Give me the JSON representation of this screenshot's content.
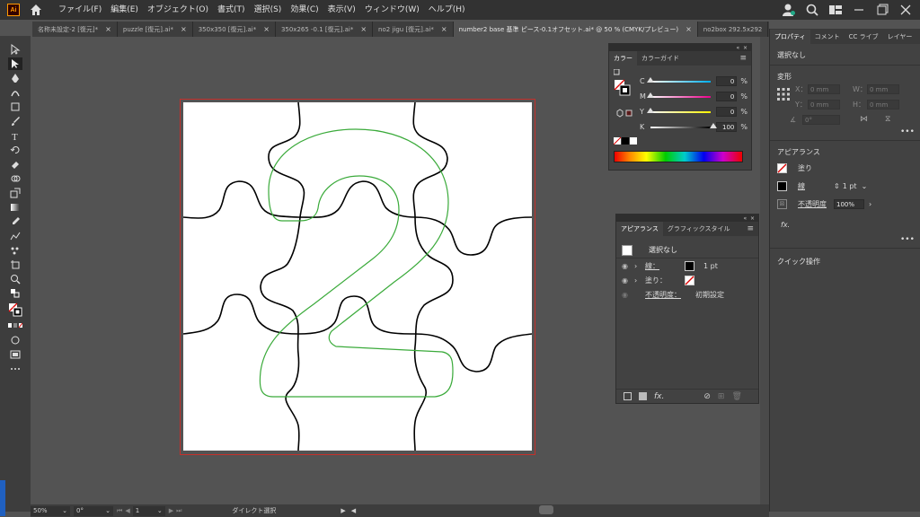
{
  "app": {
    "logo": "Ai"
  },
  "menu": [
    "ファイル(F)",
    "編集(E)",
    "オブジェクト(O)",
    "書式(T)",
    "選択(S)",
    "効果(C)",
    "表示(V)",
    "ウィンドウ(W)",
    "ヘルプ(H)"
  ],
  "tabs": [
    {
      "label": "名称未設定-2 [復元]* ",
      "active": false
    },
    {
      "label": "puzzle [復元].ai*",
      "active": false
    },
    {
      "label": "350x350 [復元].ai*",
      "active": false
    },
    {
      "label": "350x265 -0.1 [復元].ai*",
      "active": false
    },
    {
      "label": "no2 jigu [復元].ai*",
      "active": false
    },
    {
      "label": "number2 base 基準 ピース-0.1オフセット.ai* @ 50 % (CMYK/プレビュー)",
      "active": true
    },
    {
      "label": "no2box 292.5x292",
      "active": false
    }
  ],
  "color_panel": {
    "tabs": [
      "カラー",
      "カラーガイド"
    ],
    "channels": [
      {
        "label": "C",
        "value": "0",
        "fraction": 0.0
      },
      {
        "label": "M",
        "value": "0",
        "fraction": 0.0
      },
      {
        "label": "Y",
        "value": "0",
        "fraction": 0.0
      },
      {
        "label": "K",
        "value": "100",
        "fraction": 1.0
      }
    ],
    "unit": "%"
  },
  "appearance_panel": {
    "tabs": [
      "アピアランス",
      "グラフィックスタイル"
    ],
    "selection": "選択なし",
    "stroke_label": "線：",
    "stroke_value": "1 pt",
    "fill_label": "塗り：",
    "opacity_label": "不透明度：",
    "opacity_value": "初期設定"
  },
  "properties": {
    "tabs": [
      "プロパティ",
      "コメント",
      "CC ライブ",
      "レイヤー"
    ],
    "selection": "選択なし",
    "transform_title": "変形",
    "x_label": "X：",
    "x_value": "0 mm",
    "y_label": "Y：",
    "y_value": "0 mm",
    "w_label": "W：",
    "w_value": "0 mm",
    "h_label": "H：",
    "h_value": "0 mm",
    "angle_value": "0°",
    "appearance_title": "アピアランス",
    "fill_label": "塗り",
    "stroke_label": "線",
    "stroke_value": "1 pt",
    "opacity_label": "不透明度",
    "opacity_value": "100%",
    "fx_label": "fx.",
    "quick_actions": "クイック操作",
    "more": "•••"
  },
  "status": {
    "zoom": "50%",
    "rotation": "0°",
    "artboard": "1",
    "tool": "ダイレクト選択"
  },
  "colors": {
    "artboard_border": "#c4302b",
    "puzzle_line": "#000000",
    "number_outline": "#3aaa3a"
  }
}
